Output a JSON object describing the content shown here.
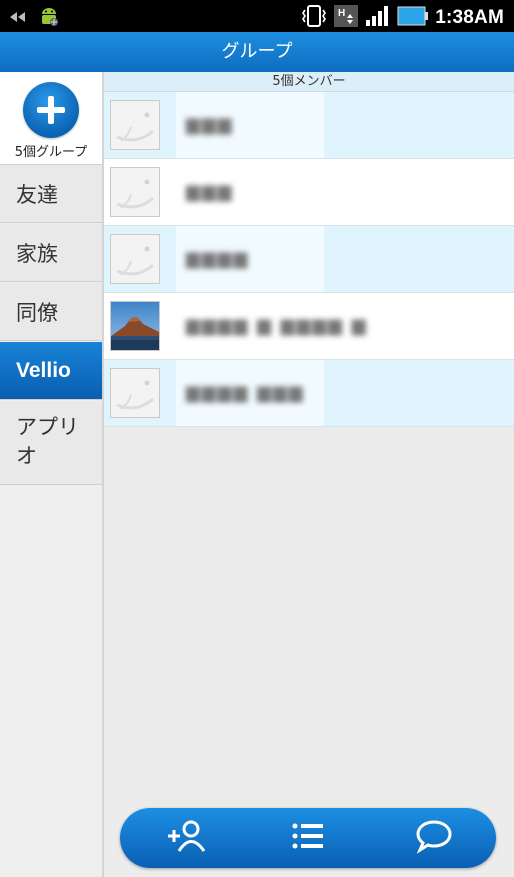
{
  "status_bar": {
    "time": "1:38AM"
  },
  "title_bar": {
    "title": "グループ"
  },
  "sidebar": {
    "add_button_caption": "5個グループ",
    "items": [
      {
        "label": "友達"
      },
      {
        "label": "家族"
      },
      {
        "label": "同僚"
      },
      {
        "label": "Vellio",
        "selected": true
      },
      {
        "label": "アプリオ"
      }
    ]
  },
  "members": {
    "header": "5個メンバー",
    "rows": [
      {
        "name": "▆▆▆",
        "avatar": "default-avatar-icon"
      },
      {
        "name": "▆▆▆",
        "avatar": "default-avatar-icon"
      },
      {
        "name": "▆▆▆▆",
        "avatar": "default-avatar-icon"
      },
      {
        "name": "▆▆▆▆ ▆ ▆▆▆▆ ▆",
        "avatar": "mountain-photo"
      },
      {
        "name": "▆▆▆▆ ▆▆▆",
        "avatar": "default-avatar-icon"
      }
    ]
  },
  "bottom_bar": {
    "buttons": [
      "add-person-icon",
      "list-icon",
      "chat-icon"
    ]
  },
  "colors": {
    "accent": "#0d6dc0",
    "row_tint": "#dff4fd"
  }
}
